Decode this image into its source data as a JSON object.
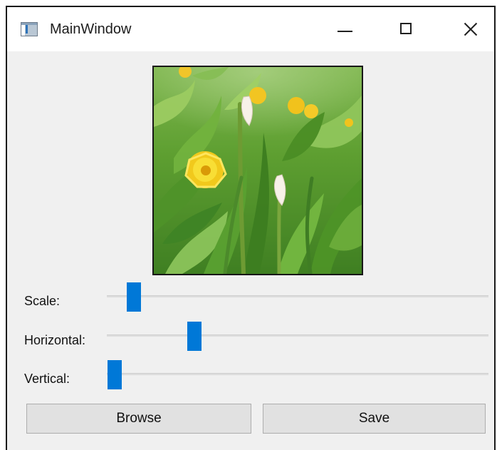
{
  "window": {
    "title": "MainWindow",
    "icon": "application-icon",
    "controls": {
      "minimize": "minimize-icon",
      "maximize": "maximize-icon",
      "close": "close-icon"
    }
  },
  "preview": {
    "kind": "photo",
    "icon": "flower-photo"
  },
  "controls": {
    "scale_label": "Scale:",
    "horizontal_label": "Horizontal:",
    "vertical_label": "Vertical:",
    "scale_value": 0.07,
    "horizontal_value": 0.23,
    "vertical_value": 0.02
  },
  "buttons": {
    "browse_label": "Browse",
    "save_label": "Save"
  },
  "colors": {
    "window_background": "#f0f0f0",
    "titlebar_background": "#ffffff",
    "slider_accent": "#0078d7",
    "button_background": "#e1e1e1",
    "button_border": "#adadad"
  }
}
